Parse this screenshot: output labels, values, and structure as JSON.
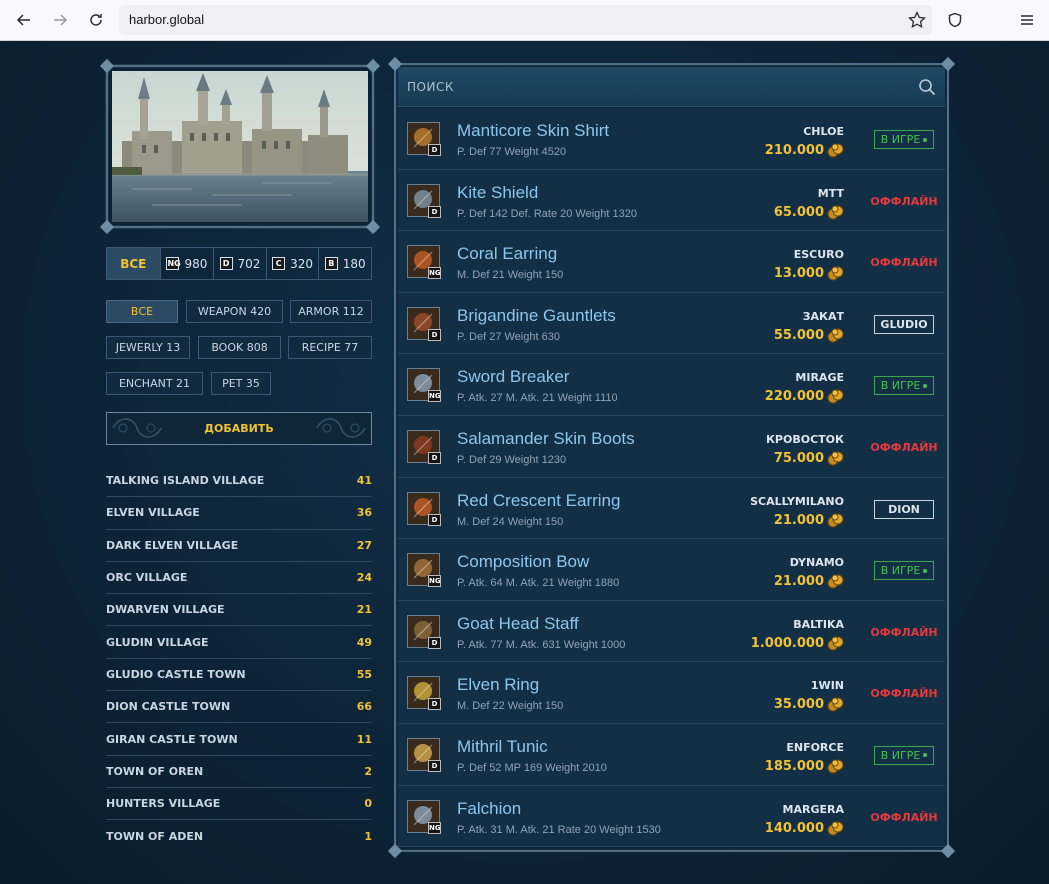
{
  "browser": {
    "url": "harbor.global",
    "colors": {
      "chrome_bg": "#f9f9fb",
      "url_bg": "#f0f0f4"
    }
  },
  "grades": [
    {
      "label": "ВСЕ",
      "badge": "",
      "count": "",
      "active": true
    },
    {
      "label": "",
      "badge": "NG",
      "count": "980",
      "active": false
    },
    {
      "label": "",
      "badge": "D",
      "count": "702",
      "active": false
    },
    {
      "label": "",
      "badge": "C",
      "count": "320",
      "active": false
    },
    {
      "label": "",
      "badge": "B",
      "count": "180",
      "active": false
    }
  ],
  "types": [
    {
      "label": "ВСЕ",
      "active": true
    },
    {
      "label": "WEAPON 420",
      "active": false
    },
    {
      "label": "ARMOR 112",
      "active": false
    },
    {
      "label": "JEWERLY 13",
      "active": false
    },
    {
      "label": "BOOK 808",
      "active": false
    },
    {
      "label": "RECIPE 77",
      "active": false
    },
    {
      "label": "ENCHANT 21",
      "active": false
    },
    {
      "label": "PET 35",
      "active": false
    }
  ],
  "add_button": "ДОБАВИТЬ",
  "towns": [
    {
      "name": "TALKING ISLAND VILLAGE",
      "count": "41"
    },
    {
      "name": "ELVEN VILLAGE",
      "count": "36"
    },
    {
      "name": "DARK ELVEN VILLAGE",
      "count": "27"
    },
    {
      "name": "ORC VILLAGE",
      "count": "24"
    },
    {
      "name": "DWARVEN VILLAGE",
      "count": "21"
    },
    {
      "name": "GLUDIN VILLAGE",
      "count": "49"
    },
    {
      "name": "GLUDIO CASTLE TOWN",
      "count": "55"
    },
    {
      "name": "DION CASTLE TOWN",
      "count": "66"
    },
    {
      "name": "GIRAN CASTLE TOWN",
      "count": "11"
    },
    {
      "name": "TOWN OF OREN",
      "count": "2"
    },
    {
      "name": "HUNTERS VILLAGE",
      "count": "0"
    },
    {
      "name": "TOWN OF ADEN",
      "count": "1"
    }
  ],
  "search": {
    "placeholder": "ПОИСК"
  },
  "items": [
    {
      "name": "Manticore Skin Shirt",
      "stats": "P. Def 77 Weight 4520",
      "grade": "D",
      "seller": "CHLOE",
      "price": "210.000",
      "status": "В ИГРЕ",
      "status_type": "online",
      "icon": "shirt-icon"
    },
    {
      "name": "Kite Shield",
      "stats": "P. Def 142 Def. Rate 20 Weight 1320",
      "grade": "D",
      "seller": "MTT",
      "price": "65.000",
      "status": "ОФФЛАЙН",
      "status_type": "offline",
      "icon": "shield-icon"
    },
    {
      "name": "Coral Earring",
      "stats": "M. Def 21 Weight 150",
      "grade": "NG",
      "seller": "ESCURO",
      "price": "13.000",
      "status": "ОФФЛАЙН",
      "status_type": "offline",
      "icon": "earring-icon"
    },
    {
      "name": "Brigandine Gauntlets",
      "stats": "P. Def 27 Weight 630",
      "grade": "D",
      "seller": "ЗАКАТ",
      "price": "55.000",
      "status": "GLUDIO",
      "status_type": "place",
      "icon": "gauntlets-icon"
    },
    {
      "name": "Sword Breaker",
      "stats": "P. Atk. 27 M. Atk. 21 Weight 1110",
      "grade": "NG",
      "seller": "MIRAGE",
      "price": "220.000",
      "status": "В ИГРЕ",
      "status_type": "online",
      "icon": "sword-icon"
    },
    {
      "name": "Salamander Skin Boots",
      "stats": "P. Def 29 Weight 1230",
      "grade": "D",
      "seller": "КРОВОСТОК",
      "price": "75.000",
      "status": "ОФФЛАЙН",
      "status_type": "offline",
      "icon": "boots-icon"
    },
    {
      "name": "Red Crescent Earring",
      "stats": "M. Def 24 Weight 150",
      "grade": "D",
      "seller": "SCALLYMILANO",
      "price": "21.000",
      "status": "DION",
      "status_type": "place",
      "icon": "earring-icon"
    },
    {
      "name": "Composition Bow",
      "stats": "P. Atk. 64 M. Atk. 21 Weight 1880",
      "grade": "NG",
      "seller": "DYNAMO",
      "price": "21.000",
      "status": "В ИГРЕ",
      "status_type": "online",
      "icon": "bow-icon"
    },
    {
      "name": "Goat Head Staff",
      "stats": "P. Atk. 77 M. Atk. 631 Weight 1000",
      "grade": "D",
      "seller": "BALTIKA",
      "price": "1.000.000",
      "status": "ОФФЛАЙН",
      "status_type": "offline",
      "icon": "staff-icon"
    },
    {
      "name": "Elven Ring",
      "stats": "M. Def 22 Weight 150",
      "grade": "D",
      "seller": "1WIN",
      "price": "35.000",
      "status": "ОФФЛАЙН",
      "status_type": "offline",
      "icon": "ring-icon"
    },
    {
      "name": "Mithril Tunic",
      "stats": "P. Def 52 MP 169 Weight 2010",
      "grade": "D",
      "seller": "ENFORCE",
      "price": "185.000",
      "status": "В ИГРЕ",
      "status_type": "online",
      "icon": "tunic-icon"
    },
    {
      "name": "Falchion",
      "stats": "P. Atk. 31 M. Atk. 21 Rate 20 Weight 1530",
      "grade": "NG",
      "seller": "MARGERA",
      "price": "140.000",
      "status": "ОФФЛАЙН",
      "status_type": "offline",
      "icon": "sword-icon"
    }
  ],
  "colors": {
    "gold": "#f1c232",
    "online": "#43c24f",
    "offline": "#e5393c",
    "item_name": "#8cc6ee",
    "panel_bg": "#132f46"
  }
}
